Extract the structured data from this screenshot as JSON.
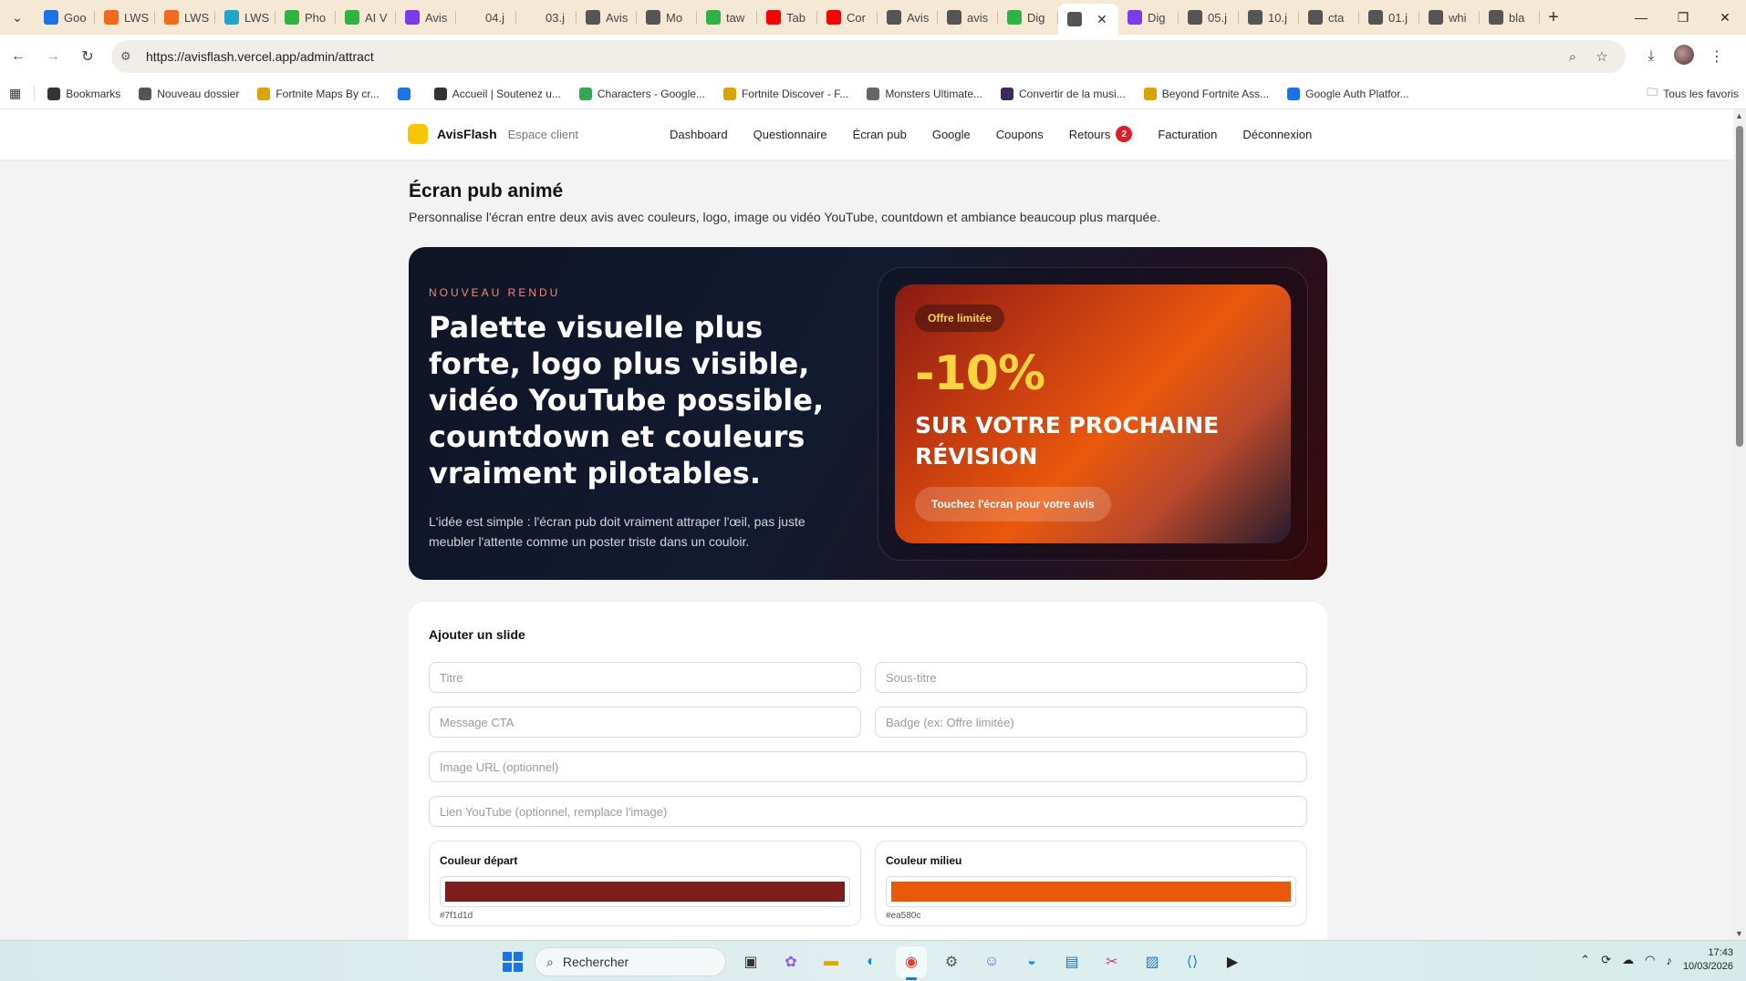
{
  "browser": {
    "tabs": [
      {
        "label": "Goo",
        "icon": "google-shield-icon",
        "color": "#1a73e8"
      },
      {
        "label": "LWS",
        "icon": "lws-icon",
        "color": "#f26b1d"
      },
      {
        "label": "LWS",
        "icon": "lws-icon",
        "color": "#f26b1d"
      },
      {
        "label": "LWS",
        "icon": "lws-cloud-icon",
        "color": "#1fa6c9"
      },
      {
        "label": "Pho",
        "icon": "lightning-icon",
        "color": "#2fb344"
      },
      {
        "label": "AI V",
        "icon": "lightning-icon",
        "color": "#2fb344"
      },
      {
        "label": "Avis",
        "icon": "grid-icon",
        "color": "#7c3aed"
      },
      {
        "label": "04.j",
        "icon": "blank-icon",
        "color": "#f5e9d6"
      },
      {
        "label": "03.j",
        "icon": "blank-icon",
        "color": "#f5e9d6"
      },
      {
        "label": "Avis",
        "icon": "globe-icon",
        "color": "#555555"
      },
      {
        "label": "Mo",
        "icon": "gear-icon",
        "color": "#555555"
      },
      {
        "label": "taw",
        "icon": "leaf-icon",
        "color": "#2fb344"
      },
      {
        "label": "Tab",
        "icon": "youtube-icon",
        "color": "#ff0000"
      },
      {
        "label": "Cor",
        "icon": "youtube-icon",
        "color": "#ff0000"
      },
      {
        "label": "Avis",
        "icon": "globe-icon",
        "color": "#555555"
      },
      {
        "label": "avis",
        "icon": "globe-icon",
        "color": "#555555"
      },
      {
        "label": "Dig",
        "icon": "lightning-icon",
        "color": "#2fb344"
      },
      {
        "label": "",
        "icon": "globe-icon",
        "color": "#555555",
        "active": true
      },
      {
        "label": "Dig",
        "icon": "grid-icon",
        "color": "#7c3aed"
      },
      {
        "label": "05.j",
        "icon": "globe-icon",
        "color": "#555555"
      },
      {
        "label": "10.j",
        "icon": "globe-icon",
        "color": "#555555"
      },
      {
        "label": "cta",
        "icon": "globe-icon",
        "color": "#555555"
      },
      {
        "label": "01.j",
        "icon": "globe-icon",
        "color": "#555555"
      },
      {
        "label": "whi",
        "icon": "globe-icon",
        "color": "#555555"
      },
      {
        "label": "bla",
        "icon": "globe-icon",
        "color": "#555555"
      }
    ],
    "url": "https://avisflash.vercel.app/admin/attract",
    "bookmarks": [
      {
        "label": "Bookmarks",
        "icon": "star-icon"
      },
      {
        "label": "Nouveau dossier",
        "icon": "folder-icon"
      },
      {
        "label": "Fortnite Maps By cr...",
        "icon": "fortnite-icon"
      },
      {
        "label": "",
        "icon": "shield-icon"
      },
      {
        "label": "Accueil | Soutenez u...",
        "icon": "book-icon"
      },
      {
        "label": "Characters - Google...",
        "icon": "drive-icon"
      },
      {
        "label": "Fortnite Discover - F...",
        "icon": "fortnite-icon"
      },
      {
        "label": "Monsters Ultimate...",
        "icon": "monster-icon"
      },
      {
        "label": "Convertir de la musi...",
        "icon": "music-icon"
      },
      {
        "label": "Beyond Fortnite Ass...",
        "icon": "fortnite-icon"
      },
      {
        "label": "Google Auth Platfor...",
        "icon": "google-shield-icon"
      }
    ],
    "all_bookmarks": "Tous les favoris"
  },
  "site": {
    "brand": "AvisFlash",
    "brand_sub": "Espace client",
    "nav": [
      "Dashboard",
      "Questionnaire",
      "Écran pub",
      "Google",
      "Coupons",
      "Retours",
      "Facturation",
      "Déconnexion"
    ],
    "returns_badge": "2"
  },
  "page": {
    "title": "Écran pub animé",
    "description": "Personnalise l'écran entre deux avis avec couleurs, logo, image ou vidéo YouTube, countdown et ambiance beaucoup plus marquée."
  },
  "hero": {
    "kicker": "NOUVEAU RENDU",
    "title": "Palette visuelle plus forte, logo plus visible, vidéo YouTube possible, countdown et couleurs vraiment pilotables.",
    "text": "L'idée est simple : l'écran pub doit vraiment attraper l'œil, pas juste meubler l'attente comme un poster triste dans un couloir.",
    "preview": {
      "badge": "Offre limitée",
      "title": "-10%",
      "subtitle": "SUR VOTRE PROCHAINE RÉVISION",
      "cta": "Touchez l'écran pour votre avis"
    }
  },
  "form": {
    "title": "Ajouter un slide",
    "placeholders": {
      "title": "Titre",
      "subtitle": "Sous-titre",
      "cta": "Message CTA",
      "badge": "Badge (ex: Offre limitée)",
      "image": "Image URL (optionnel)",
      "youtube": "Lien YouTube (optionnel, remplace l'image)"
    },
    "colors": [
      {
        "label": "Couleur départ",
        "value": "#7f1d1d"
      },
      {
        "label": "Couleur milieu",
        "value": "#ea580c"
      }
    ]
  },
  "taskbar": {
    "search": "Rechercher",
    "time": "17:43",
    "date": "10/03/2026"
  }
}
